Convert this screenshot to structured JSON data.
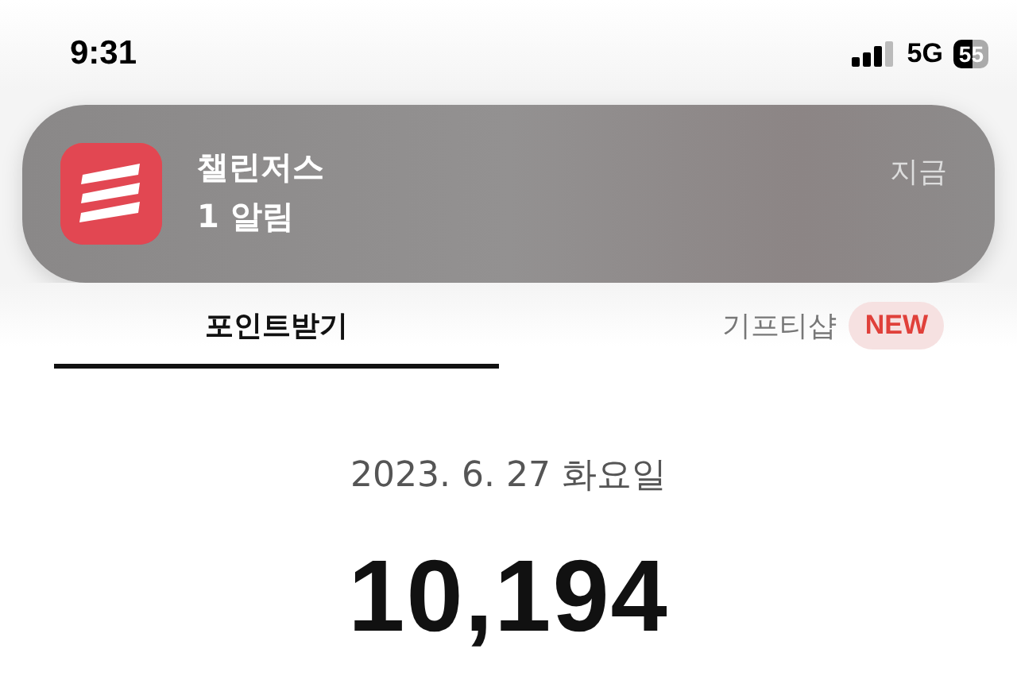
{
  "status_bar": {
    "time": "9:31",
    "network": "5G",
    "battery": "55"
  },
  "notification": {
    "app": "챌린저스",
    "message": "1 알림",
    "time": "지금"
  },
  "tabs": [
    {
      "label": "포인트받기",
      "selected": true
    },
    {
      "label": "기프티샵",
      "selected": false,
      "badge": "NEW"
    }
  ],
  "date": "2023. 6. 27 화요일",
  "points": "10,194"
}
